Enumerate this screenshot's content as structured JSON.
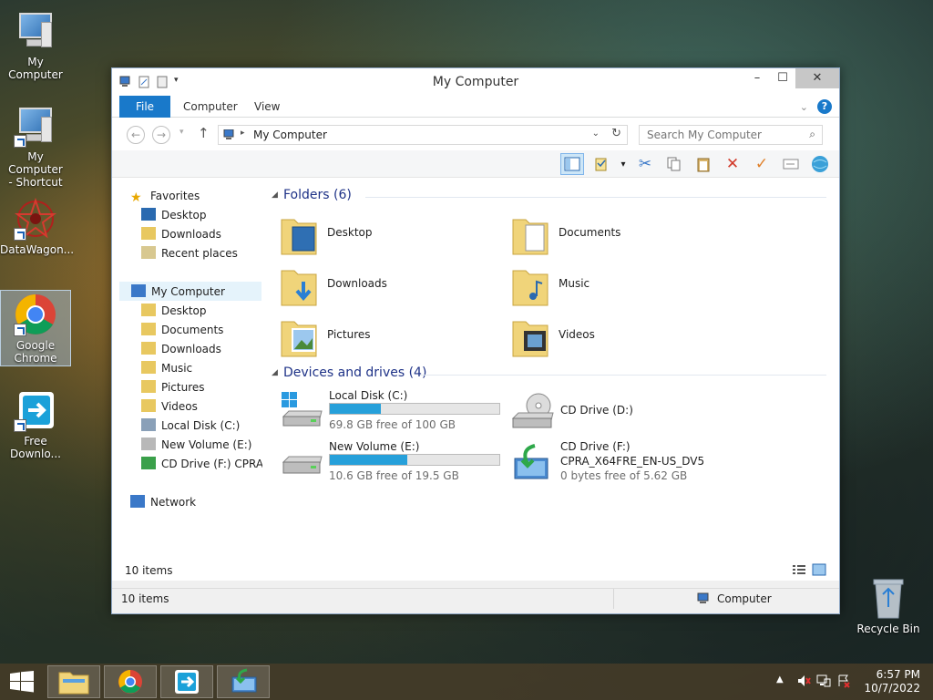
{
  "desktop": {
    "icons": [
      {
        "label": "My Computer",
        "icon": "computer-icon"
      },
      {
        "label": "My Computer\n- Shortcut",
        "line1": "My Computer",
        "line2": "- Shortcut",
        "icon": "computer-shortcut-icon"
      },
      {
        "label": "DataWagon...",
        "icon": "datawagon-icon"
      },
      {
        "label": "Google Chrome",
        "line1": "Google",
        "line2": "Chrome",
        "icon": "chrome-icon"
      },
      {
        "label": "Free Downlo...",
        "line1": "Free",
        "line2": "Downlo...",
        "icon": "free-download-icon"
      },
      {
        "label": "Recycle Bin",
        "icon": "recycle-bin-icon"
      }
    ]
  },
  "window": {
    "title": "My Computer",
    "ribbon_tabs": [
      "File",
      "Computer",
      "View"
    ],
    "address": "My Computer",
    "search_placeholder": "Search My Computer",
    "nav_pane": {
      "favorites_label": "Favorites",
      "favorites": [
        "Desktop",
        "Downloads",
        "Recent places"
      ],
      "computer_label": "My Computer",
      "computer_children": [
        "Desktop",
        "Documents",
        "Downloads",
        "Music",
        "Pictures",
        "Videos",
        "Local Disk (C:)",
        "New Volume (E:)",
        "CD Drive (F:) CPRA_X"
      ],
      "network_label": "Network"
    },
    "folders_heading": "Folders (6)",
    "folders": [
      "Desktop",
      "Documents",
      "Downloads",
      "Music",
      "Pictures",
      "Videos"
    ],
    "devices_heading": "Devices and drives (4)",
    "drives": [
      {
        "name": "Local Disk (C:)",
        "free": "69.8 GB free of 100 GB",
        "used_fraction": 0.302
      },
      {
        "name": "CD Drive (D:)"
      },
      {
        "name": "New Volume (E:)",
        "free": "10.6 GB free of 19.5 GB",
        "used_fraction": 0.456
      },
      {
        "name": "CD Drive (F:)",
        "label": "CPRA_X64FRE_EN-US_DV5",
        "free": "0 bytes free of 5.62 GB"
      }
    ],
    "items_count": "10 items",
    "status_items": "10 items",
    "status_location": "Computer"
  },
  "taskbar": {
    "time": "6:57 PM",
    "date": "10/7/2022"
  },
  "colors": {
    "accent": "#1979ca",
    "bar_fill": "#26a0da",
    "group_title": "#1e3287"
  }
}
